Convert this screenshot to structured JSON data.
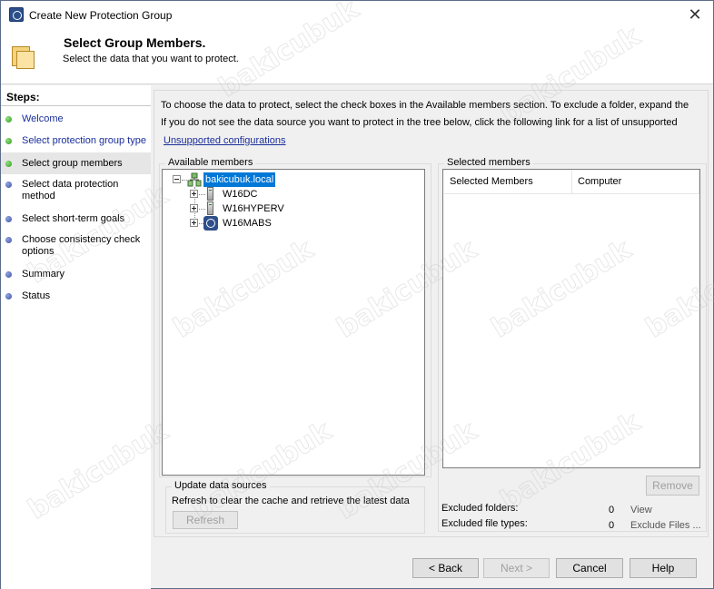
{
  "window": {
    "title": "Create New Protection Group"
  },
  "header": {
    "title": "Select Group Members.",
    "subtitle": "Select the data that you want to protect."
  },
  "sidebar": {
    "steps_label": "Steps:",
    "items": [
      {
        "label": "Welcome",
        "state": "done"
      },
      {
        "label": "Select protection group type",
        "state": "done"
      },
      {
        "label": "Select group members",
        "state": "current"
      },
      {
        "label": "Select data protection method",
        "state": "pending"
      },
      {
        "label": "Select short-term goals",
        "state": "pending"
      },
      {
        "label": "Choose consistency check options",
        "state": "pending"
      },
      {
        "label": "Summary",
        "state": "pending"
      },
      {
        "label": "Status",
        "state": "pending"
      }
    ]
  },
  "main": {
    "intro_line1": "To choose the data to protect, select the check boxes in the Available members section. To exclude a folder, expand the",
    "intro_line2": "If you do not see the data source you want to protect in the tree below, click the following link for a list of unsupported",
    "unsupported_link": "Unsupported configurations",
    "available_members_label": "Available members",
    "tree": {
      "root": "bakicubuk.local",
      "children": [
        "W16DC",
        "W16HYPERV",
        "W16MABS"
      ]
    },
    "update": {
      "label": "Update data sources",
      "text": "Refresh to clear the cache and retrieve the latest data",
      "refresh_button": "Refresh"
    },
    "selected_members_label": "Selected members",
    "columns": [
      "Selected Members",
      "Computer"
    ],
    "remove_button": "Remove",
    "excluded_folders_label": "Excluded folders:",
    "excluded_folders_count": "0",
    "view_link": "View",
    "excluded_types_label": "Excluded file types:",
    "excluded_types_count": "0",
    "exclude_files_link": "Exclude Files ..."
  },
  "footer": {
    "back": "< Back",
    "next": "Next >",
    "cancel": "Cancel",
    "help": "Help"
  },
  "watermark": "bakicubuk",
  "colors": {
    "link": "#1a2e9a",
    "selection": "#0078d7",
    "done_dot": "#2c9a1a",
    "pending_dot": "#3a4fa0"
  }
}
